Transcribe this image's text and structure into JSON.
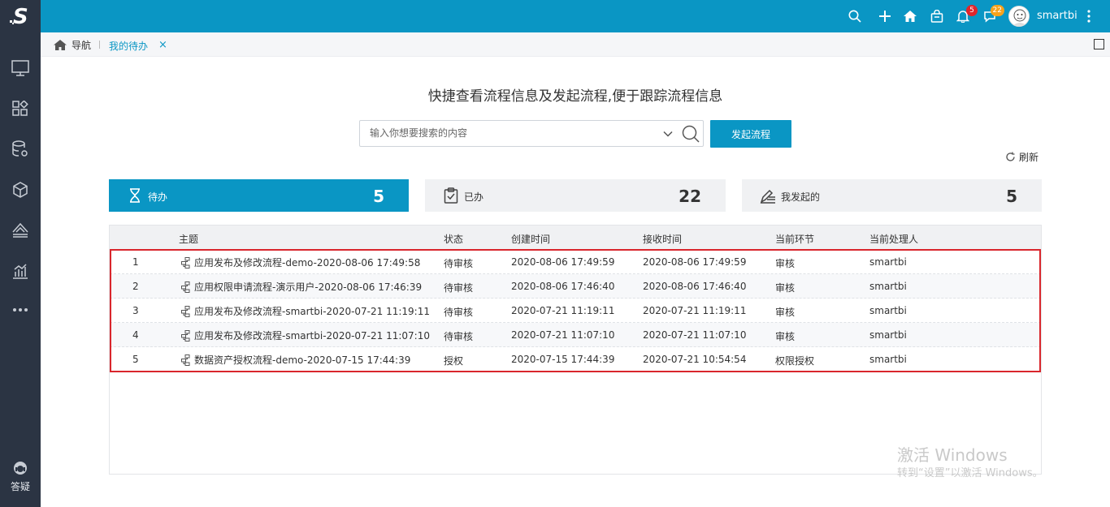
{
  "header": {
    "icons": [
      "search-icon",
      "plus-icon",
      "home-icon",
      "bag-icon",
      "bell-icon",
      "chat-icon"
    ],
    "notification_count": "5",
    "message_count": "22",
    "username": "smartbi",
    "brand_color": "#0a96c4"
  },
  "sidebar": {
    "logo": "S",
    "items": [
      "monitor-icon",
      "apps-icon",
      "database-gear-icon",
      "cube-icon",
      "layers-chart-icon",
      "bar-chart-icon",
      "more-icon"
    ],
    "help_label": "答疑"
  },
  "tabbar": {
    "home_label": "导航",
    "active_tab": "我的待办",
    "close_symbol": "×"
  },
  "main": {
    "title": "快捷查看流程信息及发起流程,便于跟踪流程信息",
    "search_placeholder": "输入你想要搜索的内容",
    "start_button": "发起流程",
    "refresh_label": "刷新"
  },
  "cards": [
    {
      "label": "待办",
      "count": "5",
      "icon": "hourglass-icon"
    },
    {
      "label": "已办",
      "count": "22",
      "icon": "clipboard-check-icon"
    },
    {
      "label": "我发起的",
      "count": "5",
      "icon": "pen-lines-icon"
    }
  ],
  "table": {
    "headers": [
      "主题",
      "状态",
      "创建时间",
      "接收时间",
      "当前环节",
      "当前处理人"
    ],
    "rows": [
      {
        "index": "1",
        "subject": "应用发布及修改流程-demo-2020-08-06 17:49:58",
        "status": "待审核",
        "created": "2020-08-06 17:49:59",
        "received": "2020-08-06 17:49:59",
        "step": "审核",
        "handler": "smartbi"
      },
      {
        "index": "2",
        "subject": "应用权限申请流程-演示用户-2020-08-06 17:46:39",
        "status": "待审核",
        "created": "2020-08-06 17:46:40",
        "received": "2020-08-06 17:46:40",
        "step": "审核",
        "handler": "smartbi"
      },
      {
        "index": "3",
        "subject": "应用发布及修改流程-smartbi-2020-07-21 11:19:11",
        "status": "待审核",
        "created": "2020-07-21 11:19:11",
        "received": "2020-07-21 11:19:11",
        "step": "审核",
        "handler": "smartbi"
      },
      {
        "index": "4",
        "subject": "应用发布及修改流程-smartbi-2020-07-21 11:07:10",
        "status": "待审核",
        "created": "2020-07-21 11:07:10",
        "received": "2020-07-21 11:07:10",
        "step": "审核",
        "handler": "smartbi"
      },
      {
        "index": "5",
        "subject": "数据资产授权流程-demo-2020-07-15 17:44:39",
        "status": "授权",
        "created": "2020-07-15 17:44:39",
        "received": "2020-07-21 10:54:54",
        "step": "权限授权",
        "handler": "smartbi"
      }
    ]
  },
  "watermark": {
    "line1": "激活 Windows",
    "line2": "转到“设置”以激活 Windows。"
  }
}
